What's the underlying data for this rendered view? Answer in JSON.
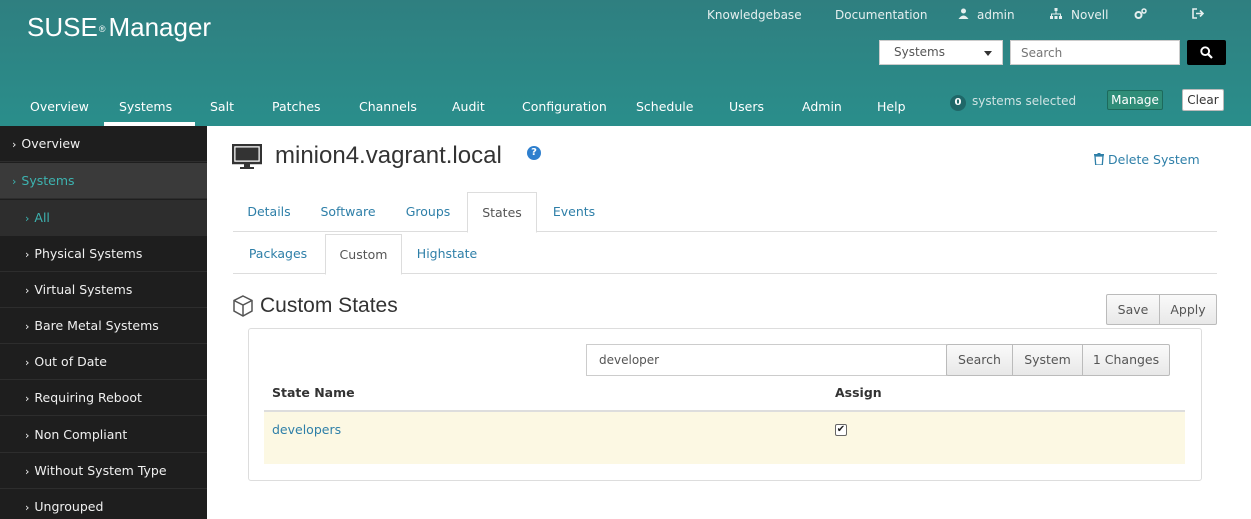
{
  "header": {
    "logo": "SUSE",
    "logo_mark": "®",
    "logo_suffix": "Manager",
    "top_links": {
      "knowledgebase": "Knowledgebase",
      "documentation": "Documentation",
      "user": "admin",
      "org": "Novell"
    },
    "search": {
      "scope": "Systems",
      "placeholder": "Search"
    },
    "nav": [
      "Overview",
      "Systems",
      "Salt",
      "Patches",
      "Channels",
      "Audit",
      "Configuration",
      "Schedule",
      "Users",
      "Admin",
      "Help"
    ],
    "active_nav": "Systems",
    "selected_count": "0",
    "selected_text": "systems selected",
    "manage_label": "Manage",
    "clear_label": "Clear"
  },
  "sidebar": {
    "items": [
      {
        "label": "Overview",
        "level": "top"
      },
      {
        "label": "Systems",
        "level": "top",
        "state": "expanded"
      },
      {
        "label": "All",
        "level": "sub",
        "state": "active"
      },
      {
        "label": "Physical Systems",
        "level": "sub"
      },
      {
        "label": "Virtual Systems",
        "level": "sub"
      },
      {
        "label": "Bare Metal Systems",
        "level": "sub"
      },
      {
        "label": "Out of Date",
        "level": "sub"
      },
      {
        "label": "Requiring Reboot",
        "level": "sub"
      },
      {
        "label": "Non Compliant",
        "level": "sub"
      },
      {
        "label": "Without System Type",
        "level": "sub"
      },
      {
        "label": "Ungrouped",
        "level": "sub"
      }
    ]
  },
  "main": {
    "title": "minion4.vagrant.local",
    "delete_label": "Delete System",
    "tabs": [
      "Details",
      "Software",
      "Groups",
      "States",
      "Events"
    ],
    "active_tab": "States",
    "subtabs": [
      "Packages",
      "Custom",
      "Highstate"
    ],
    "active_subtab": "Custom",
    "section_title": "Custom States",
    "save_label": "Save",
    "apply_label": "Apply",
    "filter_value": "developer",
    "search_label": "Search",
    "system_label": "System",
    "changes_label": "1 Changes",
    "columns": [
      "State Name",
      "Assign"
    ],
    "rows": [
      {
        "name": "developers",
        "assigned": true
      }
    ]
  },
  "colors": {
    "header": "#2a8e8b",
    "sidebar": "#1e1e1e",
    "link": "#2e7fa8",
    "row_highlight": "#fcf8e3"
  }
}
